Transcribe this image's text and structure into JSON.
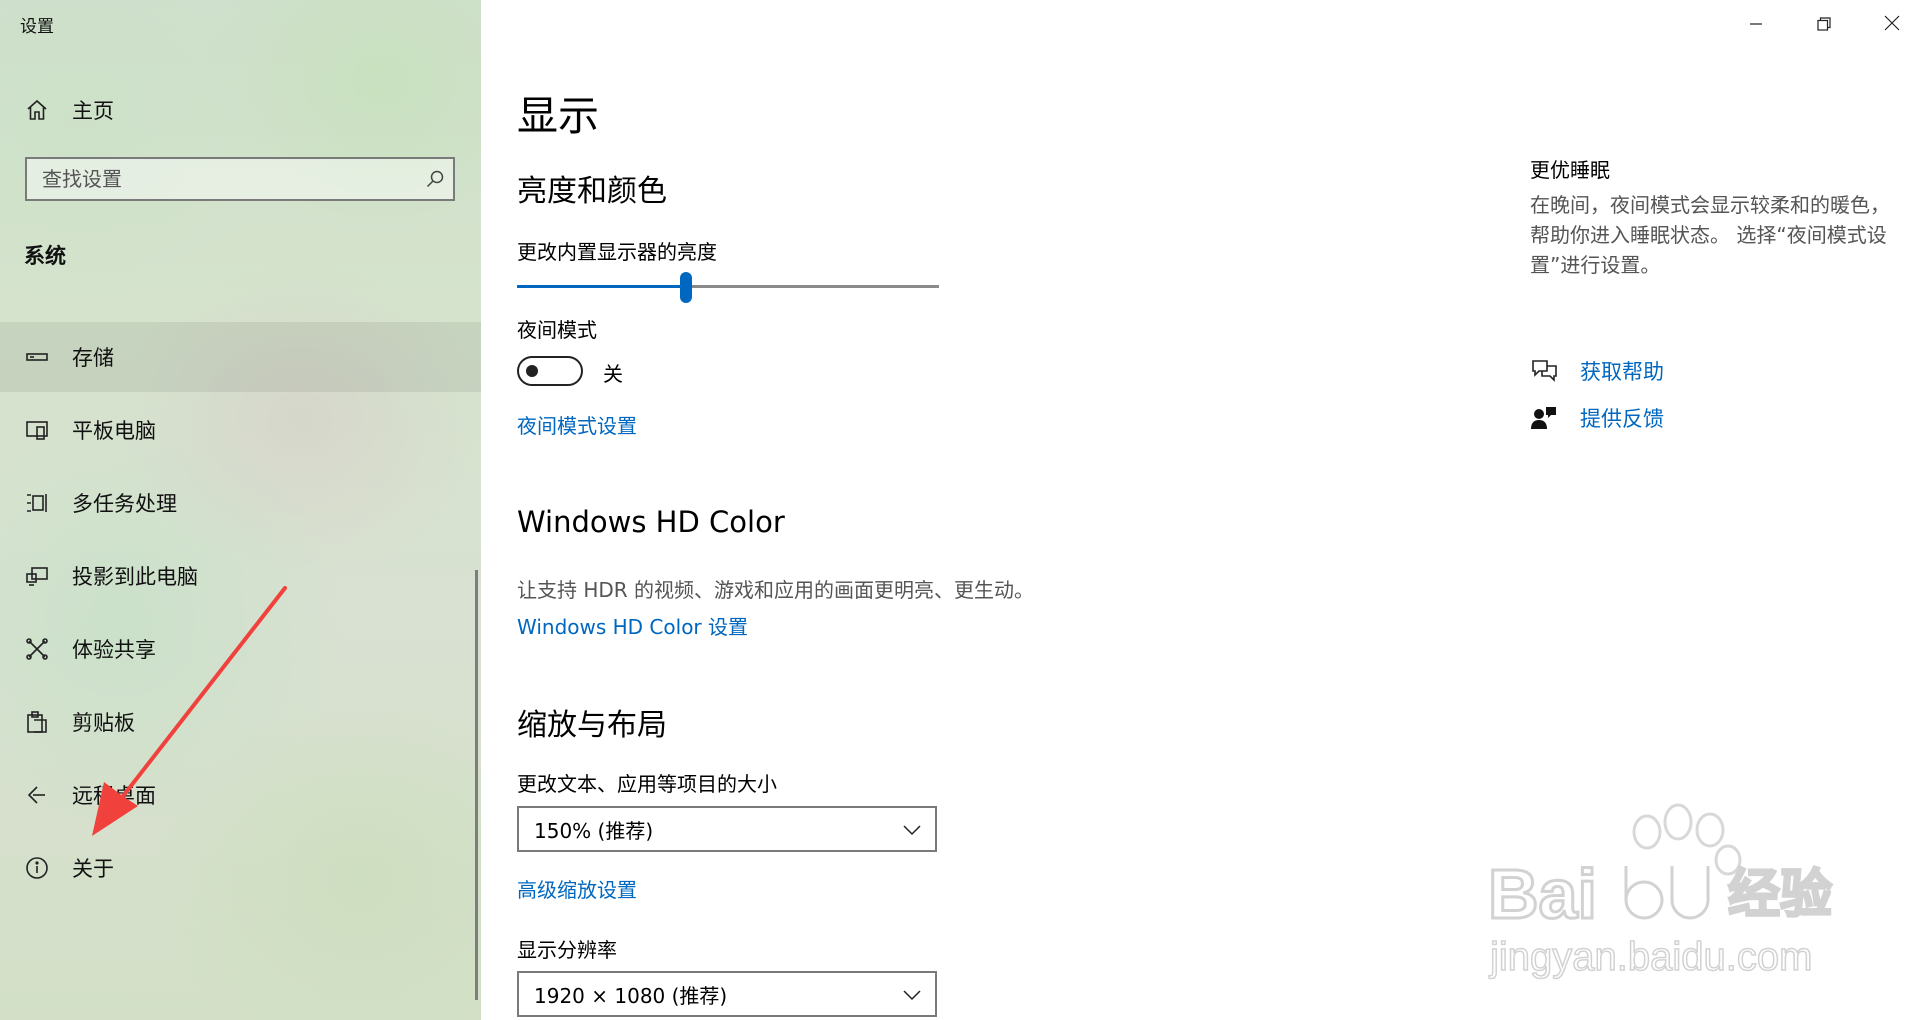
{
  "window": {
    "app_title": "设置",
    "controls": {
      "minimize": "minimize-icon",
      "restore": "restore-icon",
      "close": "close-icon"
    }
  },
  "sidebar": {
    "home_label": "主页",
    "search_placeholder": "查找设置",
    "section_title": "系统",
    "items": [
      {
        "label": "存储",
        "icon": "storage-icon",
        "selected": true
      },
      {
        "label": "平板电脑",
        "icon": "tablet-icon"
      },
      {
        "label": "多任务处理",
        "icon": "multitasking-icon"
      },
      {
        "label": "投影到此电脑",
        "icon": "project-icon"
      },
      {
        "label": "体验共享",
        "icon": "shared-experiences-icon"
      },
      {
        "label": "剪贴板",
        "icon": "clipboard-icon"
      },
      {
        "label": "远程桌面",
        "icon": "remote-desktop-icon"
      },
      {
        "label": "关于",
        "icon": "info-icon"
      }
    ]
  },
  "main": {
    "page_title": "显示",
    "brightness_section": {
      "title": "亮度和颜色",
      "slider_label": "更改内置显示器的亮度",
      "brightness_fraction": 0.4,
      "night_mode_label": "夜间模式",
      "night_mode_state": "关",
      "night_mode_on": false,
      "night_mode_settings_link": "夜间模式设置"
    },
    "hdr_section": {
      "title": "Windows HD Color",
      "description": "让支持 HDR 的视频、游戏和应用的画面更明亮、更生动。",
      "link": "Windows HD Color 设置"
    },
    "scale_section": {
      "title": "缩放与布局",
      "scale_label": "更改文本、应用等项目的大小",
      "scale_value": "150% (推荐)",
      "advanced_link": "高级缩放设置",
      "resolution_label": "显示分辨率",
      "resolution_value": "1920 × 1080 (推荐)"
    },
    "side_panel": {
      "title": "更优睡眠",
      "description": "在晚间，夜间模式会显示较柔和的暖色，帮助你进入睡眠状态。 选择“夜间模式设置”进行设置。",
      "get_help": "获取帮助",
      "feedback": "提供反馈"
    }
  },
  "watermark": {
    "brand": "Bai",
    "brand_cn": "经验",
    "url": "jingyan.baidu.com"
  },
  "colors": {
    "accent": "#0067c0",
    "annotation_arrow": "#f0413c"
  }
}
